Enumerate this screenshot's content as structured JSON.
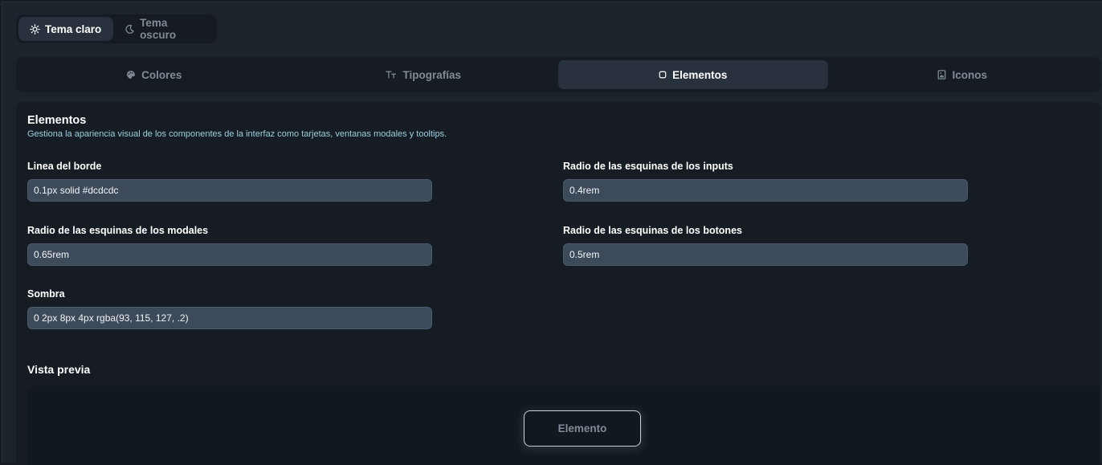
{
  "theme_toggle": {
    "light": {
      "label": "Tema claro",
      "icon": "sun-icon"
    },
    "dark": {
      "label": "Tema oscuro",
      "icon": "moon-icon"
    },
    "selected": "light"
  },
  "tabs": [
    {
      "label": "Colores",
      "icon": "palette-icon",
      "active": false
    },
    {
      "label": "Tipografías",
      "icon": "typography-icon",
      "active": false
    },
    {
      "label": "Elementos",
      "icon": "square-icon",
      "active": true
    },
    {
      "label": "Iconos",
      "icon": "image-icon",
      "active": false
    }
  ],
  "panel": {
    "title": "Elementos",
    "description": "Gestiona la apariencia visual de los componentes de la interfaz como tarjetas, ventanas modales y tooltips.",
    "fields": {
      "border": {
        "label": "Linea del borde",
        "value": "0.1px solid #dcdcdc"
      },
      "input_radius": {
        "label": "Radio de las esquinas de los inputs",
        "value": "0.4rem"
      },
      "modal_radius": {
        "label": "Radio de las esquinas de los modales",
        "value": "0.65rem"
      },
      "button_radius": {
        "label": "Radio de las esquinas de los botones",
        "value": "0.5rem"
      },
      "shadow": {
        "label": "Sombra",
        "value": "0 2px 8px 4px rgba(93, 115, 127, .2)"
      }
    },
    "preview": {
      "title": "Vista previa",
      "element_label": "Elemento"
    }
  },
  "colors": {
    "background": "#1b232c",
    "panel": "#151c23",
    "active_tab": "#27323e",
    "input_bg": "#3c4a5a",
    "muted_text": "#7f8b96",
    "description_text": "#9ccfe0"
  }
}
